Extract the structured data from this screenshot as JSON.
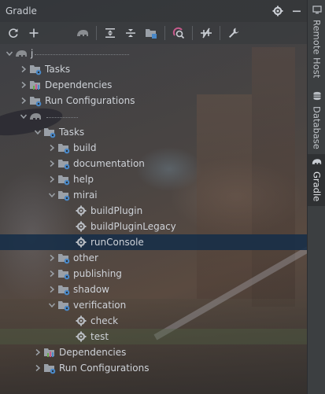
{
  "panel": {
    "title": "Gradle"
  },
  "colors": {
    "selection": "#162e48",
    "accent": "#4a88c7"
  },
  "titlebar_icons": [
    "gear-icon",
    "minimize-icon"
  ],
  "toolbar_icons": [
    "refresh-icon",
    "add-icon",
    "elephant-icon",
    "expand-all-icon",
    "collapse-all-icon",
    "group-modules-icon",
    "analyze-deps-icon",
    "offline-mode-icon",
    "settings-wrench-icon"
  ],
  "sidebar": {
    "tabs": [
      {
        "label": "Remote Host",
        "icon": "remote-host-icon"
      },
      {
        "label": "Database",
        "icon": "database-icon"
      },
      {
        "label": "Gradle",
        "icon": "elephant-icon"
      }
    ]
  },
  "tree": [
    {
      "label": "j",
      "icon": "elephant-icon",
      "obscured": true
    },
    {
      "label": "Tasks",
      "icon": "tasks-folder-icon"
    },
    {
      "label": "Dependencies",
      "icon": "dependencies-icon"
    },
    {
      "label": "Run Configurations",
      "icon": "run-config-folder-icon"
    },
    {
      "label": "",
      "icon": "elephant-icon",
      "obscured": true
    },
    {
      "label": "Tasks",
      "icon": "tasks-folder-icon"
    },
    {
      "label": "build",
      "icon": "task-group-icon"
    },
    {
      "label": "documentation",
      "icon": "task-group-icon"
    },
    {
      "label": "help",
      "icon": "task-group-icon"
    },
    {
      "label": "mirai",
      "icon": "task-group-icon"
    },
    {
      "label": "buildPlugin",
      "icon": "gear-task-icon"
    },
    {
      "label": "buildPluginLegacy",
      "icon": "gear-task-icon"
    },
    {
      "label": "runConsole",
      "icon": "gear-task-icon"
    },
    {
      "label": "other",
      "icon": "task-group-icon"
    },
    {
      "label": "publishing",
      "icon": "task-group-icon"
    },
    {
      "label": "shadow",
      "icon": "task-group-icon"
    },
    {
      "label": "verification",
      "icon": "task-group-icon"
    },
    {
      "label": "check",
      "icon": "gear-task-icon"
    },
    {
      "label": "test",
      "icon": "gear-task-icon"
    },
    {
      "label": "Dependencies",
      "icon": "dependencies-icon"
    },
    {
      "label": "Run Configurations",
      "icon": "run-config-folder-icon"
    }
  ]
}
